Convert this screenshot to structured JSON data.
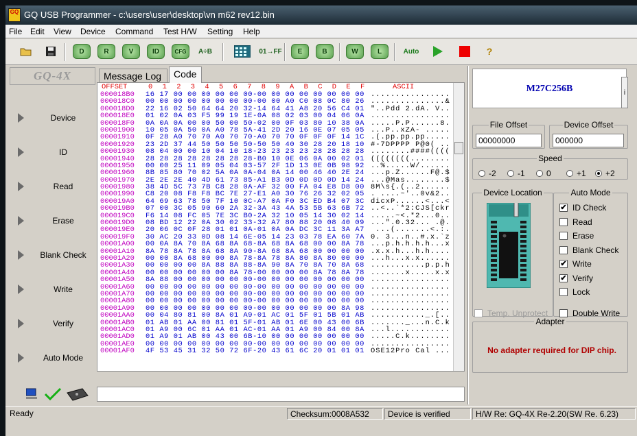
{
  "window": {
    "title": "GQ USB Programmer - c:\\users\\user\\desktop\\vn m62 rev12.bin",
    "icon_text": "GQ"
  },
  "menu": [
    "File",
    "Edit",
    "View",
    "Device",
    "Command",
    "Test H/W",
    "Setting",
    "Help"
  ],
  "toolbar": {
    "open_icon": "open-folder-icon",
    "save_icon": "save-disk-icon",
    "device_label": "D",
    "read_label": "R",
    "verify_label": "V",
    "id_label": "ID",
    "config_label": "CFG",
    "a_b_label": "A÷B",
    "calculator_icon": "calculator-icon",
    "fill_label": "01→FF",
    "erase_label": "E",
    "blank_label": "B",
    "write_label": "W",
    "lock_label": "L",
    "auto_label": "Auto",
    "run_icon": "play-icon",
    "stop_icon": "stop-icon",
    "help_label": "?"
  },
  "left_panel": {
    "logo": "GQ-4X",
    "buttons": [
      "Device",
      "ID",
      "Read",
      "Erase",
      "Blank Check",
      "Write",
      "Verify",
      "Auto Mode"
    ]
  },
  "tabs": [
    {
      "label": "Message Log",
      "active": false
    },
    {
      "label": "Code",
      "active": true
    }
  ],
  "hex": {
    "header": "OFFSET   0  1  2  3  4  5  6  7  8  9  A  B  C  D  E  F      ASCII",
    "rows": [
      {
        "offset": "000018B0",
        "bytes": "16 17 00 00 00 00 00 00-00 00 00 00 00 00 00 00",
        "ascii": "................"
      },
      {
        "offset": "000018C0",
        "bytes": "00 00 00 00 00 00 00 00-00 00 A0 C0 08 0C 80 26",
        "ascii": "...............&"
      },
      {
        "offset": "000018D0",
        "bytes": "22 16 02 50 64 64 20 32-14 64 41 A8 20 56 C4 01",
        "ascii": "\"..Pdd 2.dA. V.."
      },
      {
        "offset": "000018E0",
        "bytes": "01 02 0A 03 F5 99 19 1E-0A 08 02 03 00 04 06 0A",
        "ascii": "................"
      },
      {
        "offset": "000018F0",
        "bytes": "0A 0A 0A 00 00 50 00 50-02 00 0F 03 80 10 38 0A",
        "ascii": ".....P.P......8."
      },
      {
        "offset": "00001900",
        "bytes": "10 05 0A 50 0A A0 78 5A-41 2D 20 16 0E 07 05 05",
        "ascii": "...P..xZA- ....."
      },
      {
        "offset": "00001910",
        "bytes": "0F 28 A0 70 70 A0 70 70-A0 70 70 0F 0F 0F 14 1C",
        "ascii": ".(.pp.pp.pp....."
      },
      {
        "offset": "00001920",
        "bytes": "23 2D 37 44 50 50 50 50-50 50 40 30 28 20 18 10",
        "ascii": "#-7DPPPP P@0( .."
      },
      {
        "offset": "00001930",
        "bytes": "08 04 00 00 10 04 10 18-23 23 23 23 28 28 28 28",
        "ascii": "........####(((("
      },
      {
        "offset": "00001940",
        "bytes": "28 28 28 28 28 28 28 28-B0 10 0E 06 0A 00 02 01",
        "ascii": "((((((((........"
      },
      {
        "offset": "00001950",
        "bytes": "00 00 25 11 09 05 04 03-57 2F 1D 13 0E 0B 98 92",
        "ascii": "..%.....W/......"
      },
      {
        "offset": "00001960",
        "bytes": "8B 85 80 70 02 5A 0A 0A-04 0A 14 00 46 40 2E 24",
        "ascii": "...p.Z......F@.$"
      },
      {
        "offset": "00001970",
        "bytes": "2E 2E 2E 40 4D 61 73 85-A1 B3 0D 0D 0D 0D 14 24",
        "ascii": "...@Mas........$"
      },
      {
        "offset": "00001980",
        "bytes": "38 4D 5C 73 7B C8 28 0A-AF 32 00 FA 04 E8 D8 00",
        "ascii": "8M\\s{.(..2......"
      },
      {
        "offset": "00001990",
        "bytes": "C8 20 08 F8 F8 BC 7E 27-E1 A0 30 76 26 32 02 05",
        "ascii": ". ....~'..0v&2.."
      },
      {
        "offset": "000019A0",
        "bytes": "64 69 63 78 50 7F 10 0C-A7 0A F0 3C ED B4 07 3C",
        "ascii": "dicxP......<...<"
      },
      {
        "offset": "000019B0",
        "bytes": "07 00 3C 05 90 60 2A 32-3A 43 4A 53 5B 63 6B 72",
        "ascii": "..<..`*2:CJS[ckr"
      },
      {
        "offset": "000019C0",
        "bytes": "F6 14 08 FC 05 7E 3C B0-2A 32 10 05 14 30 02 14",
        "ascii": ".....~<.*2...0.."
      },
      {
        "offset": "000019D0",
        "bytes": "08 BD 12 22 0A 30 02 33-32 A7 80 88 20 08 40 09",
        "ascii": "...\".0.32... .@."
      },
      {
        "offset": "000019E0",
        "bytes": "20 06 0C 0F 28 01 01 0A-01 0A 0A DC 3C 11 3A A7",
        "ascii": " ...(.......<.:."
      },
      {
        "offset": "000019F0",
        "bytes": "30 AC 20 33 0D 08 14 6E-05 14 23 03 78 EA 60 7A",
        "ascii": "0. 3...n..#.x.`z"
      },
      {
        "offset": "00001A00",
        "bytes": "00 0A 8A 70 8A 68 8A 68-8A 68 8A 68 00 00 8A 78",
        "ascii": "...p.h.h.h.h...x"
      },
      {
        "offset": "00001A10",
        "bytes": "8A 78 8A 78 8A 68 8A 90-8A 68 8A 68 00 00 00 00",
        "ascii": ".x.x.h...h.h...."
      },
      {
        "offset": "00001A20",
        "bytes": "00 00 8A 68 00 00 8A 78-8A 78 8A 80 8A 80 00 00",
        "ascii": "...h...x.x......"
      },
      {
        "offset": "00001A30",
        "bytes": "00 00 00 00 8A 88 8A 88-8A 90 8A 70 8A 70 8A 68",
        "ascii": "...........p.p.h"
      },
      {
        "offset": "00001A40",
        "bytes": "00 00 00 00 00 00 8A 78-00 00 00 00 8A 78 8A 78",
        "ascii": ".......x.....x.x"
      },
      {
        "offset": "00001A50",
        "bytes": "8A 88 00 00 00 00 00 00-00 00 00 00 00 00 00 00",
        "ascii": "................"
      },
      {
        "offset": "00001A60",
        "bytes": "00 00 00 00 00 00 00 00-00 00 00 00 00 00 00 00",
        "ascii": "................"
      },
      {
        "offset": "00001A70",
        "bytes": "00 00 00 00 00 00 00 00-00 00 00 00 00 00 00 00",
        "ascii": "................"
      },
      {
        "offset": "00001A80",
        "bytes": "00 00 00 00 00 00 00 00-00 00 00 00 00 00 00 00",
        "ascii": "................"
      },
      {
        "offset": "00001A90",
        "bytes": "00 00 00 00 00 00 00 00-00 00 00 00 00 00 8A 98",
        "ascii": "................"
      },
      {
        "offset": "00001AA0",
        "bytes": "00 04 80 81 00 8A 01 A9-01 AC 01 5F 01 5B 01 AB",
        "ascii": "..........._.[.."
      },
      {
        "offset": "00001AB0",
        "bytes": "01 AB 01 AA 00 81 01 5F-01 AB 01 6E 00 43 00 6B",
        "ascii": "......._...n.C.k"
      },
      {
        "offset": "00001AC0",
        "bytes": "01 A9 00 6C 01 AA 01 AC-01 AA 01 A9 00 84 00 8A",
        "ascii": "...l............"
      },
      {
        "offset": "00001AD0",
        "bytes": "01 A9 01 AB 00 43 00 6B-10 00 00 00 00 00 00 00",
        "ascii": ".....C.k........"
      },
      {
        "offset": "00001AE0",
        "bytes": "00 00 00 00 00 00 00 00-00 00 00 00 00 00 00 00",
        "ascii": "................"
      },
      {
        "offset": "00001AF0",
        "bytes": "4F 53 45 31 32 50 72 6F-20 43 61 6C 20 01 01 01",
        "ascii": "OSE12Pro Cal ..."
      }
    ]
  },
  "chip": {
    "name": "M27C256B",
    "button_label": "i"
  },
  "offsets": {
    "file_label": "File Offset",
    "file_value": "00000000",
    "device_label": "Device Offset",
    "device_value": "000000"
  },
  "speed": {
    "label": "Speed",
    "options": [
      {
        "label": "-2",
        "checked": false
      },
      {
        "label": "-1",
        "checked": false
      },
      {
        "label": "0",
        "checked": false
      },
      {
        "label": "+1",
        "checked": false
      },
      {
        "label": "+2",
        "checked": true
      }
    ]
  },
  "device_location": {
    "label": "Device Location",
    "temp_unprotect": "Temp. Unprotect"
  },
  "auto_mode": {
    "label": "Auto Mode",
    "items": [
      {
        "label": "ID Check",
        "checked": true
      },
      {
        "label": "Read",
        "checked": false
      },
      {
        "label": "Erase",
        "checked": false
      },
      {
        "label": "Blank Check",
        "checked": false
      },
      {
        "label": "Write",
        "checked": true
      },
      {
        "label": "Verify",
        "checked": true
      },
      {
        "label": "Lock",
        "checked": false
      }
    ],
    "double_write": "Double Write"
  },
  "adapter": {
    "label": "Adapter",
    "message": "No adapter required for DIP chip."
  },
  "status": {
    "ready": "Ready",
    "checksum": "Checksum:0008A532",
    "verified": "Device is verified",
    "hw_version": "H/W Re: GQ-4X Re-2.20(SW Re. 6.23)"
  }
}
